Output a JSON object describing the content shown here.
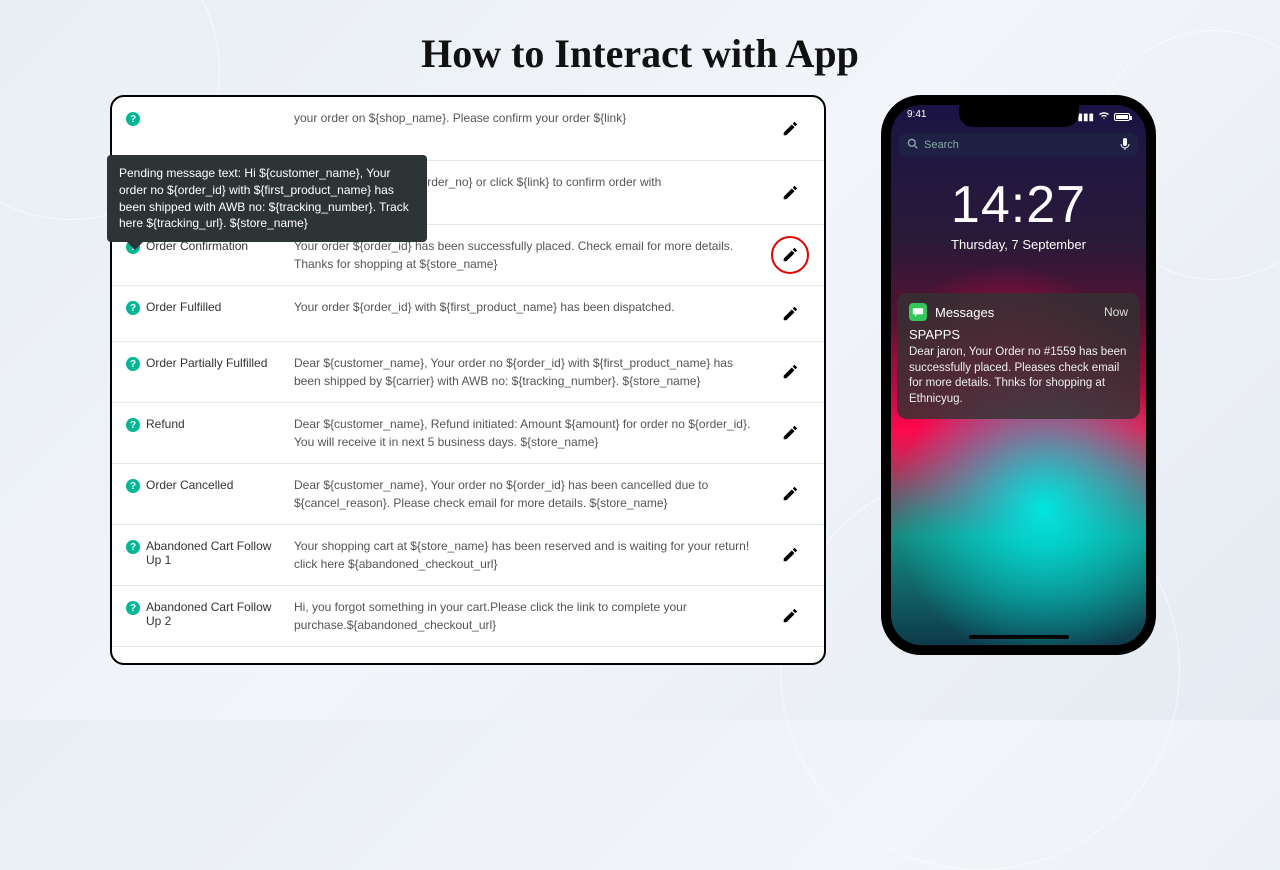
{
  "page": {
    "title": "How to Interact with App"
  },
  "tooltip": {
    "text": "Pending message text: Hi ${customer_name}, Your order no ${order_id} with ${first_product_name} has been shipped with AWB no: ${tracking_number}. Track here ${tracking_url}. ${store_name}"
  },
  "templates": [
    {
      "name": "",
      "message": "your order on ${shop_name}. Please confirm your order ${link}",
      "highlight": false
    },
    {
      "name": "",
      "message": "P code for your order ${order_no} or click ${link} to confirm order with",
      "highlight": false
    },
    {
      "name": "Order Confirmation",
      "message": "Your order ${order_id} has been successfully placed. Check email for more details. Thanks for shopping at ${store_name}",
      "highlight": true
    },
    {
      "name": "Order Fulfilled",
      "message": "Your order ${order_id} with ${first_product_name} has been dispatched.",
      "highlight": false
    },
    {
      "name": "Order Partially Fulfilled",
      "message": "Dear ${customer_name}, Your order no ${order_id} with ${first_product_name} has been shipped by ${carrier} with AWB no: ${tracking_number}. ${store_name}",
      "highlight": false
    },
    {
      "name": "Refund",
      "message": "Dear ${customer_name}, Refund initiated: Amount ${amount} for order no ${order_id}. You will receive it in next 5 business days. ${store_name}",
      "highlight": false
    },
    {
      "name": "Order Cancelled",
      "message": "Dear ${customer_name}, Your order no ${order_id} has been cancelled due to ${cancel_reason}. Please check email for more details. ${store_name}",
      "highlight": false
    },
    {
      "name": "Abandoned Cart Follow Up 1",
      "message": "Your shopping cart at ${store_name} has been reserved and is waiting for your return! click here ${abandoned_checkout_url}",
      "highlight": false
    },
    {
      "name": "Abandoned Cart Follow Up 2",
      "message": "Hi, you forgot something in your cart.Please click the link to complete your purchase.${abandoned_checkout_url}",
      "highlight": false
    }
  ],
  "phone": {
    "status_time": "9:41",
    "search_placeholder": "Search",
    "clock_time": "14:27",
    "clock_date": "Thursday, 7 September",
    "notification": {
      "app_name": "Messages",
      "when": "Now",
      "sender": "SPAPPS",
      "body": "Dear jaron, Your Order no #1559 has been successfully placed. Pleases check email for more details. Thnks for shopping at Ethnicyug."
    }
  }
}
